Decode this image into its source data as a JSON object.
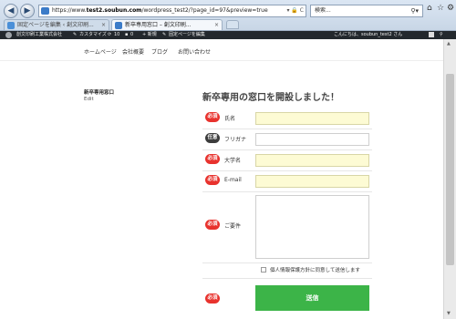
{
  "browser": {
    "url_prefix": "https://www.",
    "url_host": "test2.soubun.com",
    "url_path": "/wordpress_test2/?page_id=97&preview=true",
    "url_controls": "▾ 🔒 C",
    "search_placeholder": "検索...",
    "tabs": [
      {
        "label": "固定ページを編集 ‹ 創文印刷...",
        "close": "×"
      },
      {
        "label": "新卒専用窓口 – 創文印刷...",
        "close": "×"
      }
    ],
    "window_controls": [
      "⌂",
      "☆",
      "⚙"
    ]
  },
  "adminbar": {
    "site_name": "創文印刷工業株式会社",
    "customize": "カスタマイズ",
    "updates_count": "10",
    "comments_count": "0",
    "new_label": "+ 新規",
    "edit_label": "固定ページを編集",
    "greeting": "こんにちは、soubun_test2 さん"
  },
  "nav": {
    "items": [
      "ホームページ",
      "会社概要",
      "ブログ",
      "お問い合わせ"
    ]
  },
  "sidebar": {
    "title": "新卒専用窓口",
    "edit": "Edit"
  },
  "page": {
    "title": "新卒専用の窓口を開設しました！"
  },
  "form": {
    "required_label": "必須",
    "optional_label": "任意",
    "fields": [
      {
        "label": "氏名",
        "required": true
      },
      {
        "label": "フリガナ",
        "required": false
      },
      {
        "label": "大学名",
        "required": true
      },
      {
        "label": "E-mail",
        "required": true
      },
      {
        "label": "ご要件",
        "required": true
      }
    ],
    "consent_text": "個人情報保護方針に同意して送信します",
    "submit_label": "送信"
  },
  "colors": {
    "required_badge": "#e8322d",
    "optional_badge": "#3c3c3c",
    "submit": "#3cb448",
    "input_highlight": "#fdfbd4"
  }
}
